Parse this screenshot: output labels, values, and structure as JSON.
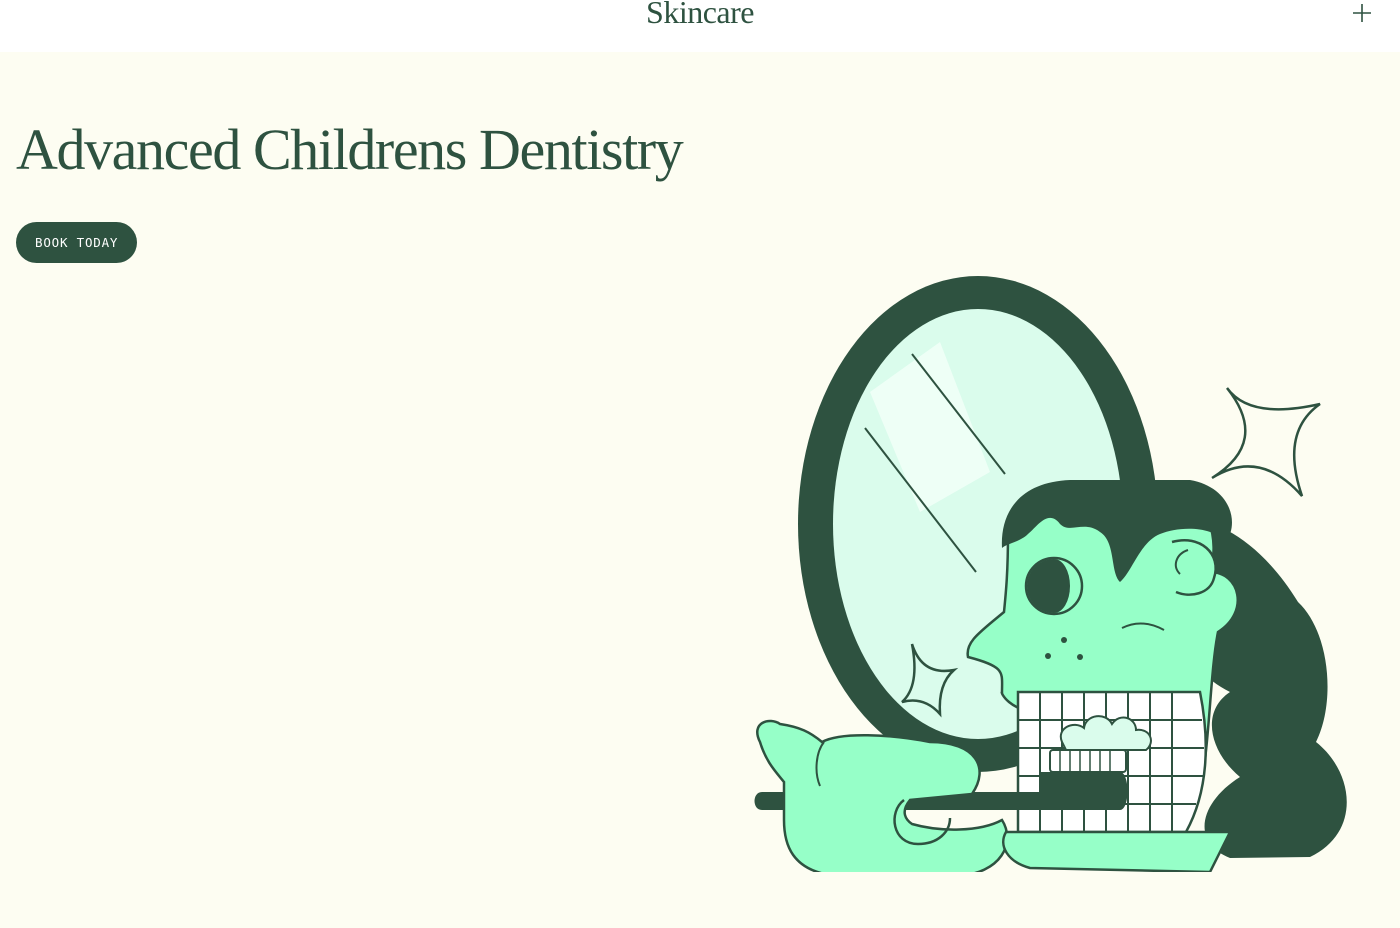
{
  "header": {
    "brand": "Skincare",
    "menu_icon": "plus-icon"
  },
  "hero": {
    "headline": "Advanced Childrens Dentistry",
    "cta_label": "BOOK TODAY",
    "illustration": "child-brushing-teeth-illustration"
  },
  "colors": {
    "primary": "#2e5240",
    "background": "#fdfdf2",
    "header_bg": "#ffffff",
    "skin": "#96ffc8",
    "mirror": "#dafcec"
  }
}
